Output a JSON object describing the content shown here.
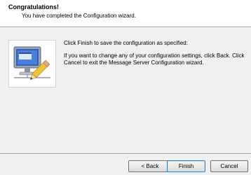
{
  "header": {
    "title": "Congratulations!",
    "subtitle": "You have completed the Configuration wizard."
  },
  "body": {
    "line1": "Click Finish to save the configuration as specified:",
    "line2": "If you want to change any of your configuration settings, click Back. Click Cancel to exit the Message Server Configuration wizard."
  },
  "icon": {
    "name": "server-configuration-icon"
  },
  "buttons": {
    "back": "< Back",
    "finish": "Finish",
    "cancel": "Cancel"
  },
  "colors": {
    "background": "#f0f0f0",
    "header_background": "#ffffff",
    "finish_border": "#3c7fb1"
  }
}
